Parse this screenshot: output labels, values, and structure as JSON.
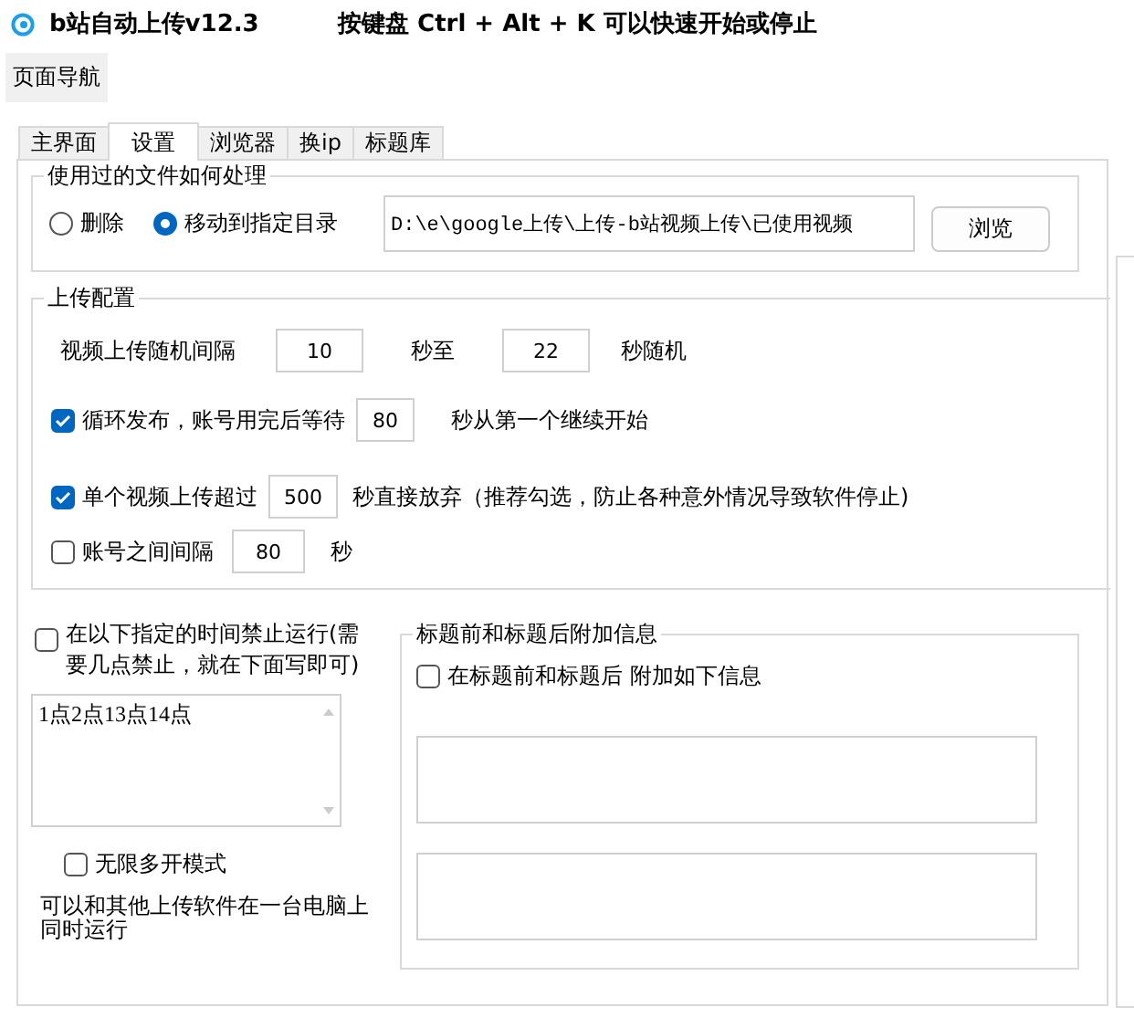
{
  "window": {
    "title": "b站自动上传v12.3",
    "hotkey_hint": "按键盘 Ctrl + Alt + K  可以快速开始或停止"
  },
  "nav_button": "页面导航",
  "tabs": [
    {
      "label": "主界面",
      "selected": false
    },
    {
      "label": "设置",
      "selected": true
    },
    {
      "label": "浏览器",
      "selected": false
    },
    {
      "label": "换ip",
      "selected": false
    },
    {
      "label": "标题库",
      "selected": false
    }
  ],
  "file_handling": {
    "title": "使用过的文件如何处理",
    "options": [
      {
        "label": "删除",
        "selected": false
      },
      {
        "label": "移动到指定目录",
        "selected": true
      }
    ],
    "path": "D:\\e\\google上传\\上传-b站视频上传\\已使用视频",
    "browse_button": "浏览"
  },
  "upload_config": {
    "title": "上传配置",
    "interval": {
      "label": "视频上传随机间隔",
      "min": "10",
      "mid_label": "秒至",
      "max": "22",
      "suffix": "秒随机"
    },
    "rows": [
      {
        "label": "循环发布，账号用完后等待",
        "checked": true,
        "value": "80",
        "suffix": "秒从第一个继续开始"
      },
      {
        "label": "单个视频上传超过",
        "checked": true,
        "value": "500",
        "suffix": "秒直接放弃（推荐勾选，防止各种意外情况导致软件停止)"
      },
      {
        "label": "账号之间间隔",
        "checked": false,
        "value": "80",
        "suffix": "秒"
      }
    ]
  },
  "forbid_time": {
    "label": "在以下指定的时间禁止运行(需要几点禁止，就在下面写即可)",
    "checked": false,
    "value": "1点2点13点14点"
  },
  "multi_open": {
    "label": "无限多开模式",
    "checked": false,
    "note": "可以和其他上传软件在一台电脑上同时运行"
  },
  "title_extra": {
    "title": "标题前和标题后附加信息",
    "label": "在标题前和标题后 附加如下信息",
    "checked": false
  }
}
